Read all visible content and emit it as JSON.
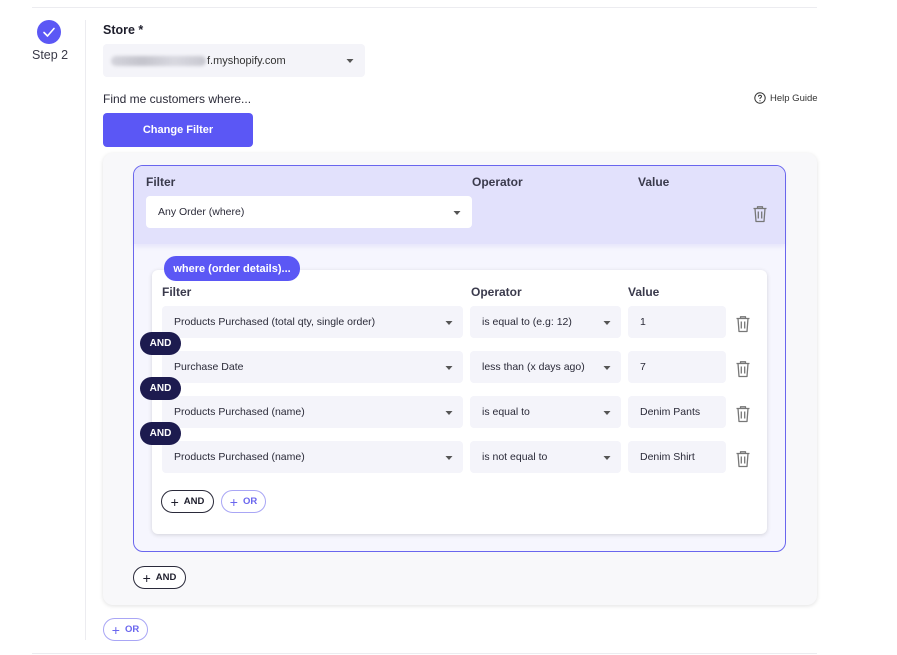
{
  "step": {
    "label": "Step 2"
  },
  "store": {
    "label": "Store *",
    "value": "f.myshopify.com"
  },
  "filter_intro": "Find me customers where...",
  "help_guide": "Help Guide",
  "change_filter_button": "Change Filter",
  "top_group": {
    "headers": {
      "filter": "Filter",
      "operator": "Operator",
      "value": "Value"
    },
    "filter_value": "Any Order (where)"
  },
  "sub_group": {
    "tag": "where (order details)...",
    "headers": {
      "filter": "Filter",
      "operator": "Operator",
      "value": "Value"
    },
    "rows": [
      {
        "filter": "Products Purchased (total qty, single order)",
        "operator": "is equal to (e.g: 12)",
        "value": "1"
      },
      {
        "filter": "Purchase Date",
        "operator": "less than (x days ago)",
        "value": "7"
      },
      {
        "filter": "Products Purchased (name)",
        "operator": "is equal to",
        "value": "Denim Pants"
      },
      {
        "filter": "Products Purchased (name)",
        "operator": "is not equal to",
        "value": "Denim Shirt"
      }
    ],
    "connector": "AND",
    "add_and": "AND",
    "add_or": "OR"
  },
  "group_add_and": "AND",
  "outer_add_or": "OR",
  "colors": {
    "accent": "#5b57f5",
    "dark_pill": "#1d1b4f",
    "group_header": "#e2e1fc"
  },
  "icons": [
    "check-icon",
    "chevron-down-icon",
    "help-circle-icon",
    "trash-icon",
    "plus-icon"
  ]
}
